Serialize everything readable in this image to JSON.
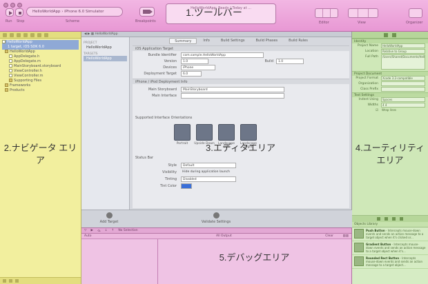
{
  "toolbar": {
    "scheme": "HelloWorldApp › iPhone 6.0 Simulator",
    "run_label": "Run",
    "stop_label": "Stop",
    "scheme_label": "Scheme",
    "breakpoints_label": "Breakpoints",
    "activity_text": "HelloWorldApp: Ready | Today at ...",
    "area_label": "1.ツールバー",
    "editor_label": "Editor",
    "view_label": "View",
    "organizer_label": "Organizer"
  },
  "navigator": {
    "project_name": "HelloWorldApp",
    "project_sub": "1 target, iOS SDK 6.0",
    "items": [
      {
        "label": "HelloWorldApp",
        "folder": true
      },
      {
        "label": "AppDelegate.h",
        "folder": false
      },
      {
        "label": "AppDelegate.m",
        "folder": false
      },
      {
        "label": "MainStoryboard.storyboard",
        "folder": false
      },
      {
        "label": "ViewController.h",
        "folder": false
      },
      {
        "label": "ViewController.m",
        "folder": false
      },
      {
        "label": "Supporting Files",
        "folder": true
      },
      {
        "label": "Frameworks",
        "folder": true
      },
      {
        "label": "Products",
        "folder": true
      }
    ],
    "area_label": "2.ナビゲータ エリア"
  },
  "editor": {
    "jumpbar": "HelloWorldApp",
    "project_header": "PROJECT",
    "project_item": "HelloWorldApp",
    "targets_header": "TARGETS",
    "target_item": "HelloWorldApp",
    "tabs": [
      "Summary",
      "Info",
      "Build Settings",
      "Build Phases",
      "Build Rules"
    ],
    "section_ios": "iOS Application Target",
    "bundle_identifier_label": "Bundle Identifier",
    "bundle_identifier_value": "com.sample.HelloWorldApp",
    "version_label": "Version",
    "version_value": "1.0",
    "build_label": "Build",
    "build_value": "1.0",
    "devices_label": "Devices",
    "devices_value": "iPhone",
    "deployment_label": "Deployment Target",
    "deployment_value": "6.0",
    "section_deploy": "iPhone / iPod Deployment Info",
    "main_storyboard_label": "Main Storyboard",
    "main_storyboard_value": "MainStoryboard",
    "main_interface_label": "Main Interface",
    "main_interface_value": "",
    "orientations_label": "Supported Interface Orientations",
    "orientations": [
      "Portrait",
      "Upside Down",
      "Landscape Left",
      "Landscape Right"
    ],
    "status_bar_label": "Status Bar",
    "style_label": "Style",
    "style_value": "Default",
    "visibility_label": "Visibility",
    "visibility_value": "Hide during application launch",
    "tinting_label": "Tinting",
    "tinting_value": "Disabled",
    "tint_color_label": "Tint Color",
    "add_target_label": "Add Target",
    "validate_label": "Validate Settings",
    "area_label": "3.エディタエリア"
  },
  "debug": {
    "selection": "No Selection",
    "scope": "Auto",
    "output": "All Output",
    "clear_label": "Clear",
    "area_label": "5.デバッグエリア"
  },
  "utility": {
    "identity_header": "Identity",
    "project_name_label": "Project Name",
    "project_name_value": "HelloWorldApp",
    "location_label": "Location",
    "location_value": "Relative to Group",
    "full_path_label": "Full Path",
    "full_path_value": "/Users/Shared/Documents/HelloWorldApp.xcodeproj",
    "project_document_header": "Project Document",
    "project_format_label": "Project Format",
    "project_format_value": "Xcode 3.2-compatible",
    "organization_label": "Organization",
    "organization_value": "",
    "class_prefix_label": "Class Prefix",
    "class_prefix_value": "",
    "text_settings_header": "Text Settings",
    "indent_using_label": "Indent Using",
    "indent_using_value": "Spaces",
    "widths_label": "Widths",
    "widths_value": "4   4",
    "wrap_lines_label": "Wrap lines",
    "library_selector": "Objects Library",
    "library_items": [
      {
        "title": "Push Button",
        "desc": "Intercepts mouse-down events and sends an action message to a target object when it's clicked or..."
      },
      {
        "title": "Gradient Button",
        "desc": "Intercepts mouse-down events and sends an action message to a target object when it's..."
      },
      {
        "title": "Rounded Rect Button",
        "desc": "Intercepts mouse-down events and sends an action message to a target object..."
      }
    ],
    "area_label": "4.ユーティリティ エリア"
  }
}
